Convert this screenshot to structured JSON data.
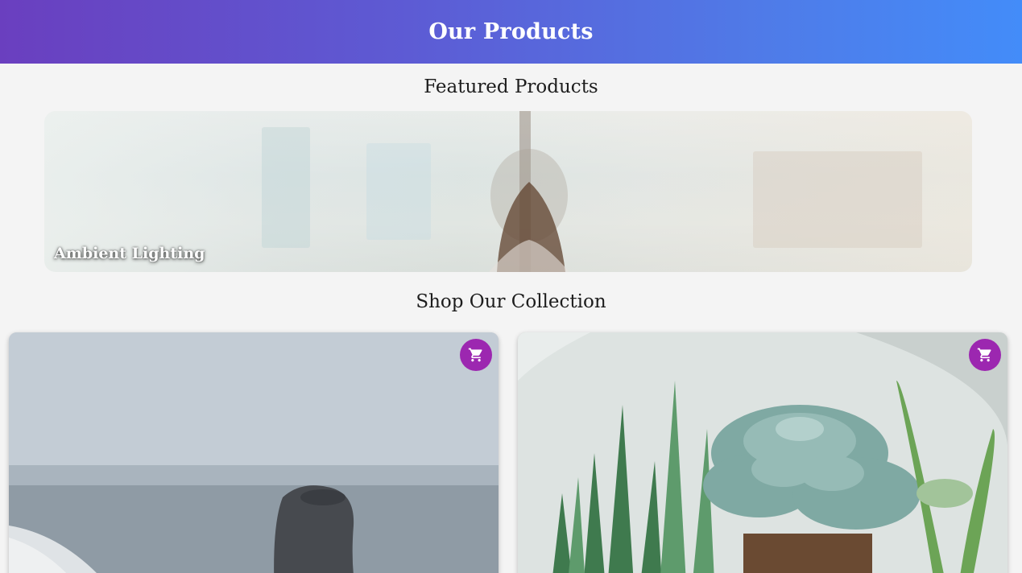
{
  "header": {
    "title": "Our Products"
  },
  "featured": {
    "heading": "Featured Products",
    "banner": {
      "caption": "Ambient Lighting"
    }
  },
  "collection": {
    "heading": "Shop Our Collection",
    "products": [
      {
        "image": "stone-on-beach-photo",
        "action_icon": "cart-icon"
      },
      {
        "image": "succulent-terrarium-photo",
        "action_icon": "cart-icon"
      }
    ]
  },
  "colors": {
    "header_gradient_start": "#6a3fbf",
    "header_gradient_end": "#438cf9",
    "cart_button": "#9c27b0",
    "page_background": "#f4f4f4"
  }
}
